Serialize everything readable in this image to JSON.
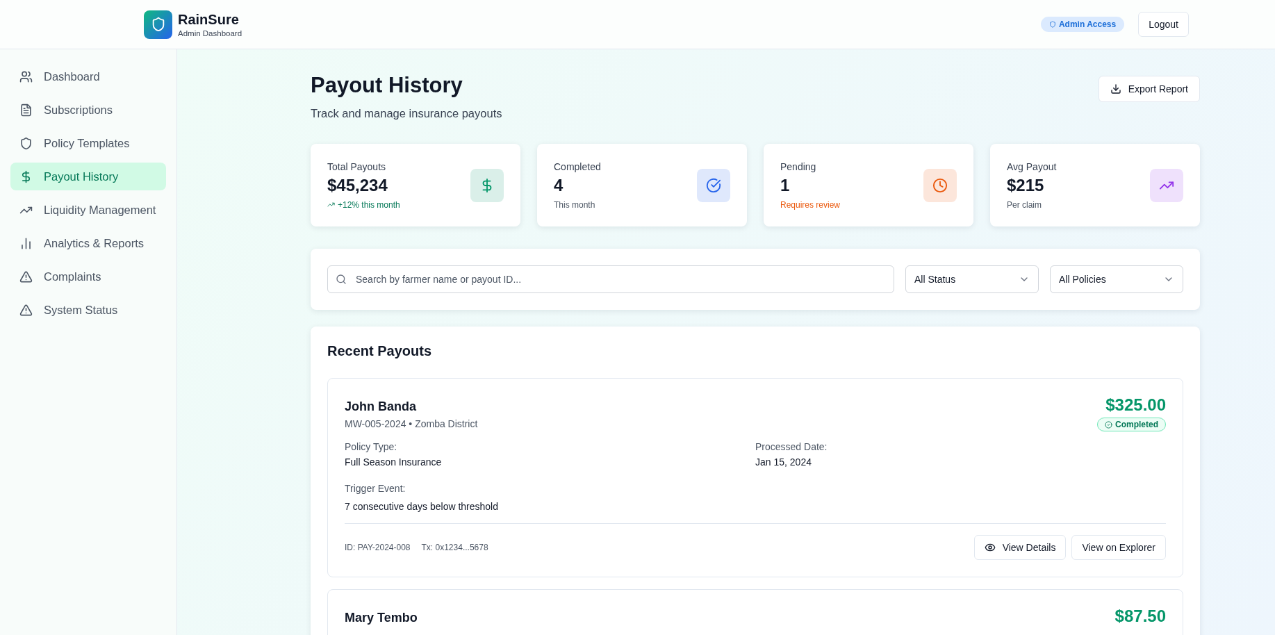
{
  "header": {
    "brand": "RainSure",
    "subtitle": "Admin Dashboard",
    "badge": "Admin Access",
    "logout": "Logout"
  },
  "sidebar": {
    "items": [
      {
        "label": "Dashboard",
        "selected": false
      },
      {
        "label": "Subscriptions",
        "selected": false
      },
      {
        "label": "Policy Templates",
        "selected": false
      },
      {
        "label": "Payout History",
        "selected": true
      },
      {
        "label": "Liquidity Management",
        "selected": false
      },
      {
        "label": "Analytics & Reports",
        "selected": false
      },
      {
        "label": "Complaints",
        "selected": false
      },
      {
        "label": "System Status",
        "selected": false
      }
    ]
  },
  "page": {
    "title": "Payout History",
    "subtitle": "Track and manage insurance payouts",
    "export": "Export Report"
  },
  "stats": [
    {
      "label": "Total Payouts",
      "value": "$45,234",
      "note": "+12% this month",
      "kind": "trend",
      "color": "#059669"
    },
    {
      "label": "Completed",
      "value": "4",
      "note": "This month",
      "kind": "note",
      "color": "#2563eb"
    },
    {
      "label": "Pending",
      "value": "1",
      "note": "Requires review",
      "kind": "warning",
      "color": "#ea580c"
    },
    {
      "label": "Avg Payout",
      "value": "$215",
      "note": "Per claim",
      "kind": "note",
      "color": "#9333ea"
    }
  ],
  "filters": {
    "search": {
      "placeholder": "Search by farmer name or payout ID..."
    },
    "selects": [
      "All Status",
      "All Policies"
    ]
  },
  "recent": {
    "title": "Recent Payouts",
    "payouts": [
      {
        "name": "John Banda",
        "ref": "MW-005-2024 • Zomba District",
        "amount": "$325.00",
        "status": {
          "label": "Completed",
          "kind": "completed"
        },
        "fields": [
          {
            "label": "Policy Type:",
            "value": "Full Season Insurance"
          },
          {
            "label": "Processed Date:",
            "value": "Jan 15, 2024"
          }
        ],
        "trigger": {
          "label": "Trigger Event:",
          "value": "7 consecutive days below threshold"
        },
        "id": "ID: PAY-2024-008",
        "tx": "Tx: 0x1234...5678",
        "actions": [
          "View Details",
          "View on Explorer"
        ]
      },
      {
        "name": "Mary Tembo",
        "amount": "$87.50"
      }
    ]
  }
}
